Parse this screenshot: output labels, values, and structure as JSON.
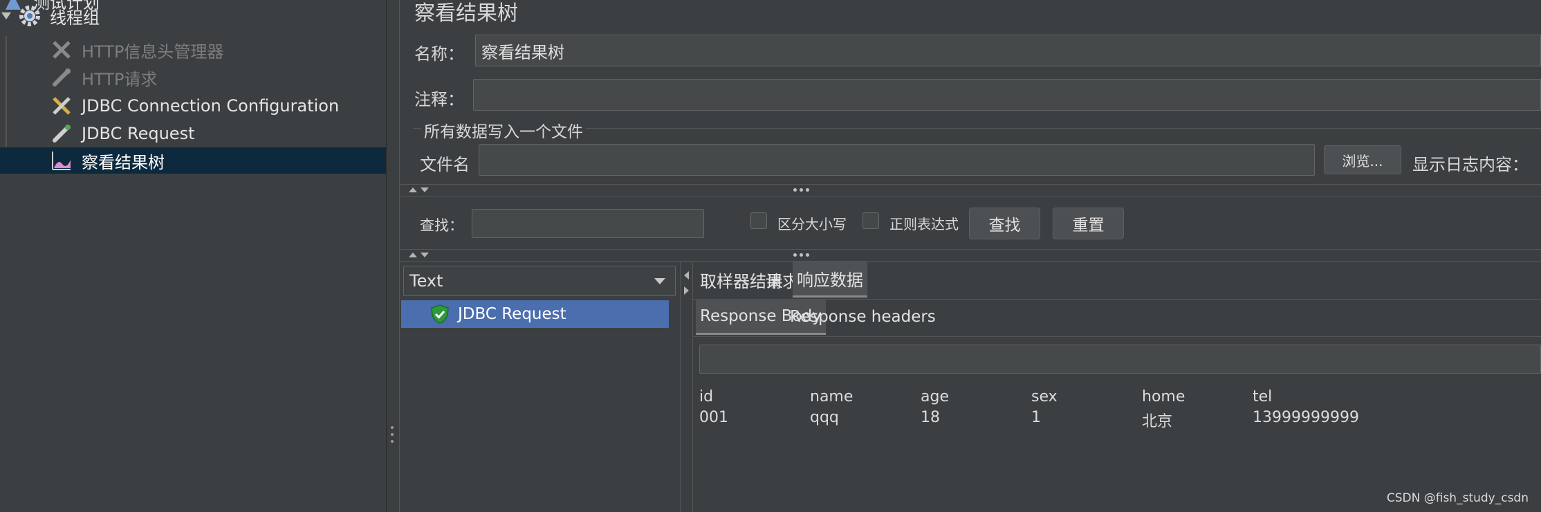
{
  "tree": {
    "items": [
      {
        "label": "测试计划",
        "icon": "test-plan-icon"
      },
      {
        "label": "线程组",
        "icon": "gear-icon"
      },
      {
        "label": "HTTP信息头管理器",
        "icon": "wrench-icon"
      },
      {
        "label": "HTTP请求",
        "icon": "pipette-icon"
      },
      {
        "label": "JDBC Connection Configuration",
        "icon": "wrench-screwdriver-icon"
      },
      {
        "label": "JDBC Request",
        "icon": "pipette-icon"
      },
      {
        "label": "察看结果树",
        "icon": "chart-icon"
      }
    ]
  },
  "panel": {
    "title": "察看结果树",
    "name_label": "名称：",
    "name_value": "察看结果树",
    "comment_label": "注释：",
    "comment_value": "",
    "file_group_title": "所有数据写入一个文件",
    "filename_label": "文件名",
    "filename_value": "",
    "browse_button": "浏览...",
    "show_log_label": "显示日志内容："
  },
  "search": {
    "label": "查找：",
    "value": "",
    "case_sensitive_label": "区分大小写",
    "regex_label": "正则表达式",
    "find_button": "查找",
    "reset_button": "重置"
  },
  "results": {
    "renderer_selected": "Text",
    "samples": [
      {
        "label": "JDBC Request",
        "status": "success"
      }
    ],
    "tabs": [
      "取样器结果",
      "请求",
      "响应数据"
    ],
    "active_tab": "响应数据",
    "subtabs": [
      "Response Body",
      "Response headers"
    ],
    "active_subtab": "Response Body",
    "table": {
      "headers": [
        "id",
        "name",
        "age",
        "sex",
        "home",
        "tel"
      ],
      "rows": [
        [
          "001",
          "qqq",
          "18",
          "1",
          "北京",
          "13999999999"
        ]
      ]
    }
  },
  "watermark": "CSDN @fish_study_csdn",
  "colors": {
    "background": "#3c3f41",
    "selected_tree_row": "#0d293e",
    "selected_sample_row": "#4b6eaf",
    "success_shield": "#2e9b3a"
  }
}
